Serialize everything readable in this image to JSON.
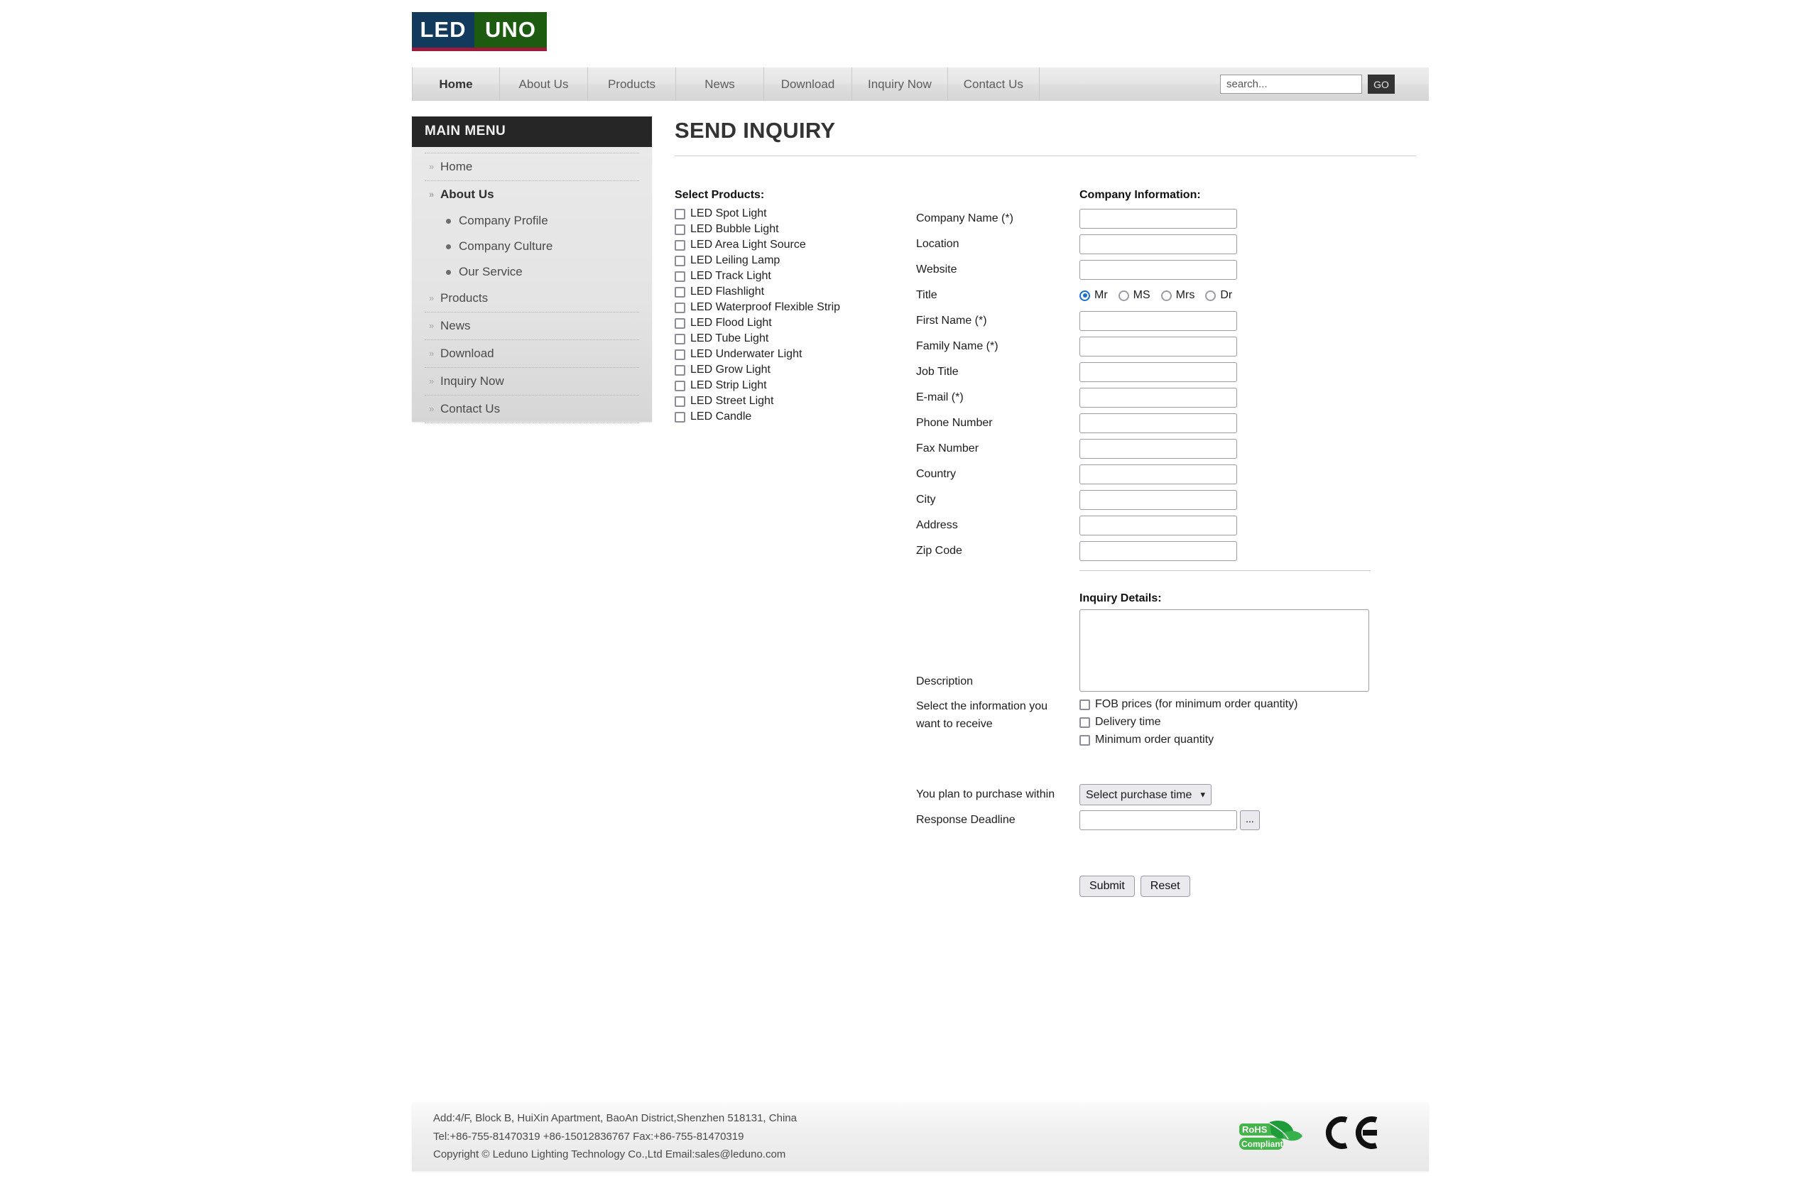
{
  "brand": {
    "logo_left": "LED",
    "logo_right": "UNO",
    "colors": {
      "left": "#123a5c",
      "right": "#1d5c10",
      "underline": "#9d1b3a"
    }
  },
  "nav": {
    "items": [
      {
        "label": "Home",
        "active": true
      },
      {
        "label": "About Us",
        "active": false
      },
      {
        "label": "Products",
        "active": false
      },
      {
        "label": "News",
        "active": false
      },
      {
        "label": "Download",
        "active": false
      },
      {
        "label": "Inquiry Now",
        "active": false
      },
      {
        "label": "Contact Us",
        "active": false
      }
    ],
    "search": {
      "value": "",
      "placeholder": "search...",
      "button": "GO"
    }
  },
  "sidebar": {
    "title": "MAIN MENU",
    "items": [
      {
        "label": "Home",
        "bold": false,
        "type": "item"
      },
      {
        "label": "About Us",
        "bold": true,
        "type": "item"
      },
      {
        "label": "Company Profile",
        "type": "sub"
      },
      {
        "label": "Company Culture",
        "type": "sub"
      },
      {
        "label": "Our Service",
        "type": "sub"
      },
      {
        "label": "Products",
        "bold": false,
        "type": "item"
      },
      {
        "label": "News",
        "bold": false,
        "type": "item"
      },
      {
        "label": "Download",
        "bold": false,
        "type": "item"
      },
      {
        "label": "Inquiry Now",
        "bold": false,
        "type": "item"
      },
      {
        "label": "Contact Us",
        "bold": false,
        "type": "item"
      }
    ]
  },
  "page": {
    "title": "SEND INQUIRY"
  },
  "products": {
    "heading": "Select Products:",
    "items": [
      {
        "label": "LED Spot Light",
        "checked": false
      },
      {
        "label": "LED Bubble Light",
        "checked": false
      },
      {
        "label": "LED Area Light Source",
        "checked": false
      },
      {
        "label": "LED Leiling Lamp",
        "checked": false
      },
      {
        "label": "LED Track Light",
        "checked": false
      },
      {
        "label": "LED Flashlight",
        "checked": false
      },
      {
        "label": "LED Waterproof Flexible Strip",
        "checked": false
      },
      {
        "label": "LED Flood Light",
        "checked": false
      },
      {
        "label": "LED Tube Light",
        "checked": false
      },
      {
        "label": "LED Underwater Light",
        "checked": false
      },
      {
        "label": "LED Grow Light",
        "checked": false
      },
      {
        "label": "LED Strip Light",
        "checked": false
      },
      {
        "label": "LED Street Light",
        "checked": false
      },
      {
        "label": "LED Candle",
        "checked": false
      }
    ]
  },
  "company_information": {
    "heading": "Company Information:",
    "fields": [
      {
        "label": "Company Name (*)",
        "value": "",
        "type": "text"
      },
      {
        "label": "Location",
        "value": "",
        "type": "text"
      },
      {
        "label": "Website",
        "value": "",
        "type": "text"
      },
      {
        "label": "Title",
        "type": "radio"
      },
      {
        "label": "First Name (*)",
        "value": "",
        "type": "text"
      },
      {
        "label": "Family Name (*)",
        "value": "",
        "type": "text"
      },
      {
        "label": "Job Title",
        "value": "",
        "type": "text"
      },
      {
        "label": "E-mail (*)",
        "value": "",
        "type": "text"
      },
      {
        "label": "Phone Number",
        "value": "",
        "type": "text"
      },
      {
        "label": "Fax Number",
        "value": "",
        "type": "text"
      },
      {
        "label": "Country",
        "value": "",
        "type": "text"
      },
      {
        "label": "City",
        "value": "",
        "type": "text"
      },
      {
        "label": "Address",
        "value": "",
        "type": "text"
      },
      {
        "label": "Zip Code",
        "value": "",
        "type": "text"
      }
    ],
    "title_options": [
      {
        "label": "Mr",
        "checked": true
      },
      {
        "label": "MS",
        "checked": false
      },
      {
        "label": "Mrs",
        "checked": false
      },
      {
        "label": "Dr",
        "checked": false
      }
    ]
  },
  "inquiry_details": {
    "heading": "Inquiry Details:",
    "description_label": "Description",
    "description_value": "",
    "info_label_line1": "Select the information you",
    "info_label_line2": "want to receive",
    "info_options": [
      {
        "label": "FOB prices (for minimum order quantity)",
        "checked": false
      },
      {
        "label": "Delivery time",
        "checked": false
      },
      {
        "label": "Minimum order quantity",
        "checked": false
      }
    ],
    "purchase_label": "You plan to purchase within",
    "purchase_selected": "Select purchase time",
    "deadline_label": "Response Deadline",
    "deadline_value": "",
    "deadline_picker_button": "...",
    "submit_label": "Submit",
    "reset_label": "Reset"
  },
  "footer": {
    "line1": "Add:4/F, Block B, HuiXin Apartment, BaoAn District,Shenzhen 518131, China",
    "line2": "Tel:+86-755-81470319   +86-15012836767   Fax:+86-755-81470319",
    "line3": "Copyright © Leduno Lighting Technology Co.,Ltd        Email:sales@leduno.com",
    "rohs_top": "RoHS",
    "rohs_bottom": "Compliant",
    "ce_mark": "CE"
  }
}
